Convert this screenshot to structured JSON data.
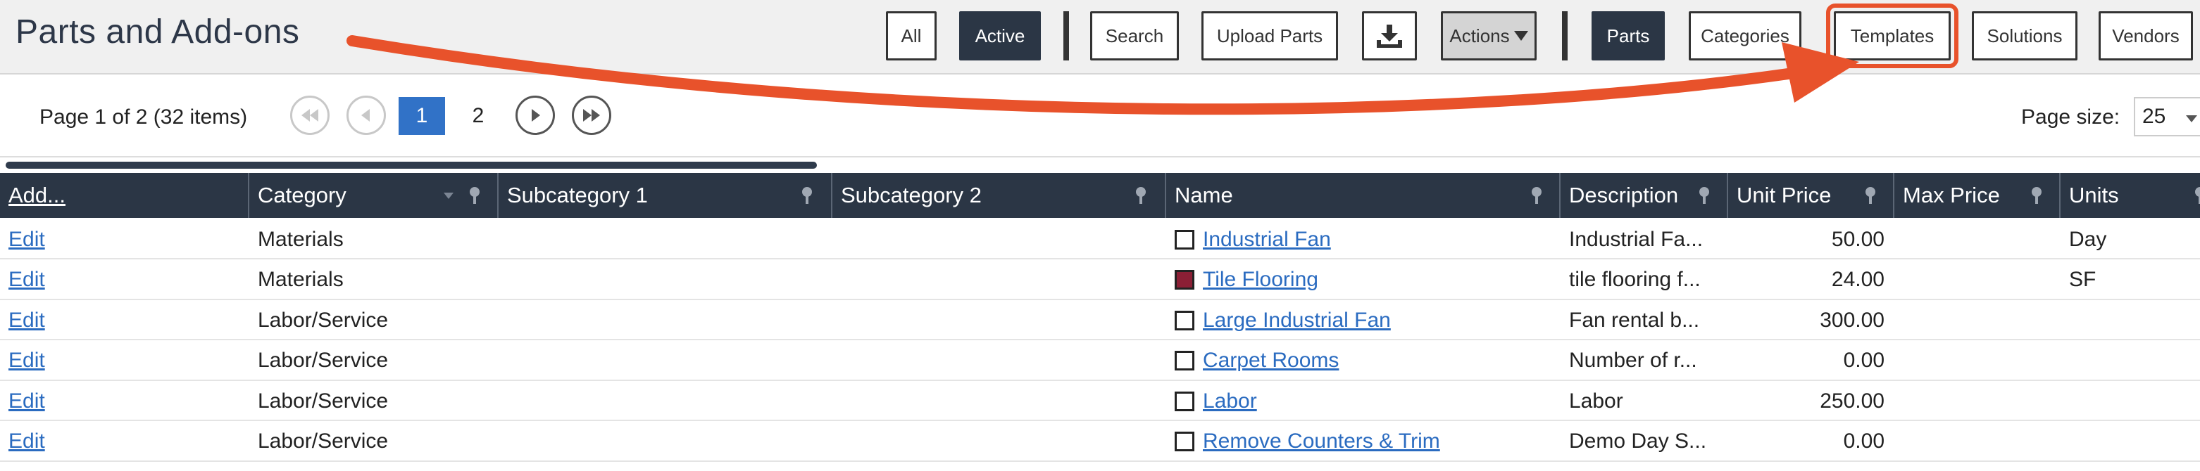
{
  "header": {
    "title": "Parts and Add-ons",
    "buttons": {
      "all": "All",
      "active": "Active",
      "search": "Search",
      "upload_parts": "Upload Parts",
      "actions": "Actions",
      "parts": "Parts",
      "categories": "Categories",
      "templates": "Templates",
      "solutions": "Solutions",
      "vendors": "Vendors"
    },
    "icons": {
      "download": "download-icon",
      "actions_caret": "caret-down-icon"
    }
  },
  "pager": {
    "info": "Page 1 of 2 (32 items)",
    "pages": [
      "1",
      "2"
    ],
    "current_page": "1",
    "page_size_label": "Page size:",
    "page_size_value": "25"
  },
  "grid": {
    "columns": [
      "Add...",
      "Category",
      "Subcategory 1",
      "Subcategory 2",
      "Name",
      "Description",
      "Unit Price",
      "Max Price",
      "Units"
    ],
    "rows": [
      {
        "action": "Edit",
        "category": "Materials",
        "sub1": "",
        "sub2": "",
        "name": "Industrial Fan",
        "swatch_color": "#ffffff",
        "description": "Industrial Fa...",
        "unit_price": "50.00",
        "max_price": "",
        "units": "Day"
      },
      {
        "action": "Edit",
        "category": "Materials",
        "sub1": "",
        "sub2": "",
        "name": "Tile Flooring",
        "swatch_color": "#8b1f35",
        "description": "tile flooring f...",
        "unit_price": "24.00",
        "max_price": "",
        "units": "SF"
      },
      {
        "action": "Edit",
        "category": "Labor/Service",
        "sub1": "",
        "sub2": "",
        "name": "Large Industrial Fan",
        "swatch_color": "#ffffff",
        "description": "Fan rental b...",
        "unit_price": "300.00",
        "max_price": "",
        "units": ""
      },
      {
        "action": "Edit",
        "category": "Labor/Service",
        "sub1": "",
        "sub2": "",
        "name": "Carpet Rooms",
        "swatch_color": "#ffffff",
        "description": "Number of r...",
        "unit_price": "0.00",
        "max_price": "",
        "units": ""
      },
      {
        "action": "Edit",
        "category": "Labor/Service",
        "sub1": "",
        "sub2": "",
        "name": "Labor",
        "swatch_color": "#ffffff",
        "description": "Labor",
        "unit_price": "250.00",
        "max_price": "",
        "units": ""
      },
      {
        "action": "Edit",
        "category": "Labor/Service",
        "sub1": "",
        "sub2": "",
        "name": "Remove Counters & Trim",
        "swatch_color": "#ffffff",
        "description": "Demo Day S...",
        "unit_price": "0.00",
        "max_price": "",
        "units": ""
      }
    ]
  },
  "colors": {
    "header_dark": "#2b3645",
    "link": "#2a6bc0",
    "active_page": "#3172c7",
    "annotation": "#e8522b"
  }
}
